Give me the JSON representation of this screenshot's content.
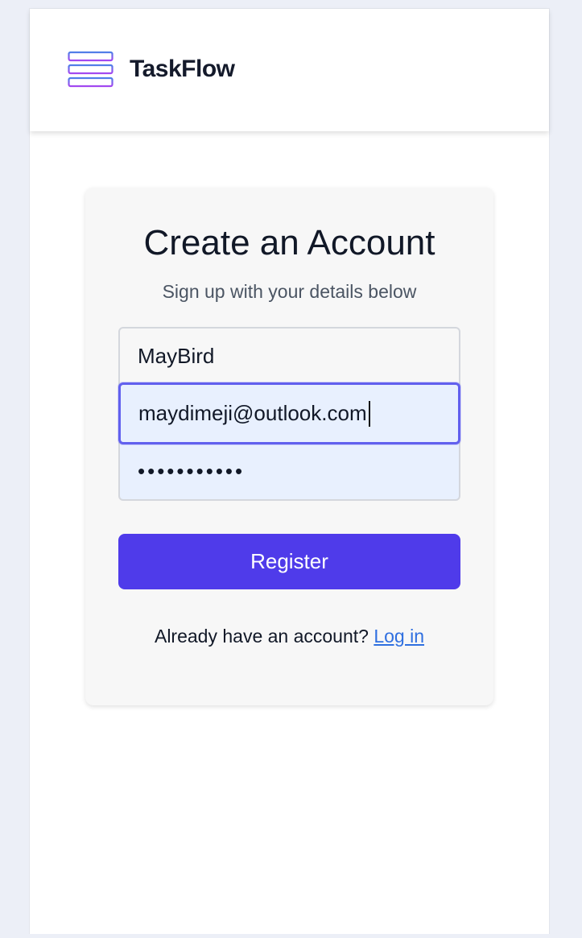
{
  "header": {
    "brand": "TaskFlow",
    "logo_icon": "stacked-bars-logo-icon"
  },
  "form": {
    "title": "Create an Account",
    "subtitle": "Sign up with your details below",
    "username_value": "MayBird",
    "email_value": "maydimeji@outlook.com",
    "password_display": "•••••••••••",
    "register_label": "Register",
    "login_prompt": "Already have an account?",
    "login_link": "Log in"
  },
  "colors": {
    "accent": "#4f3bea",
    "focus_border": "#6160ee",
    "autofill_bg": "#e8f0fe",
    "link": "#2f6fe0"
  }
}
